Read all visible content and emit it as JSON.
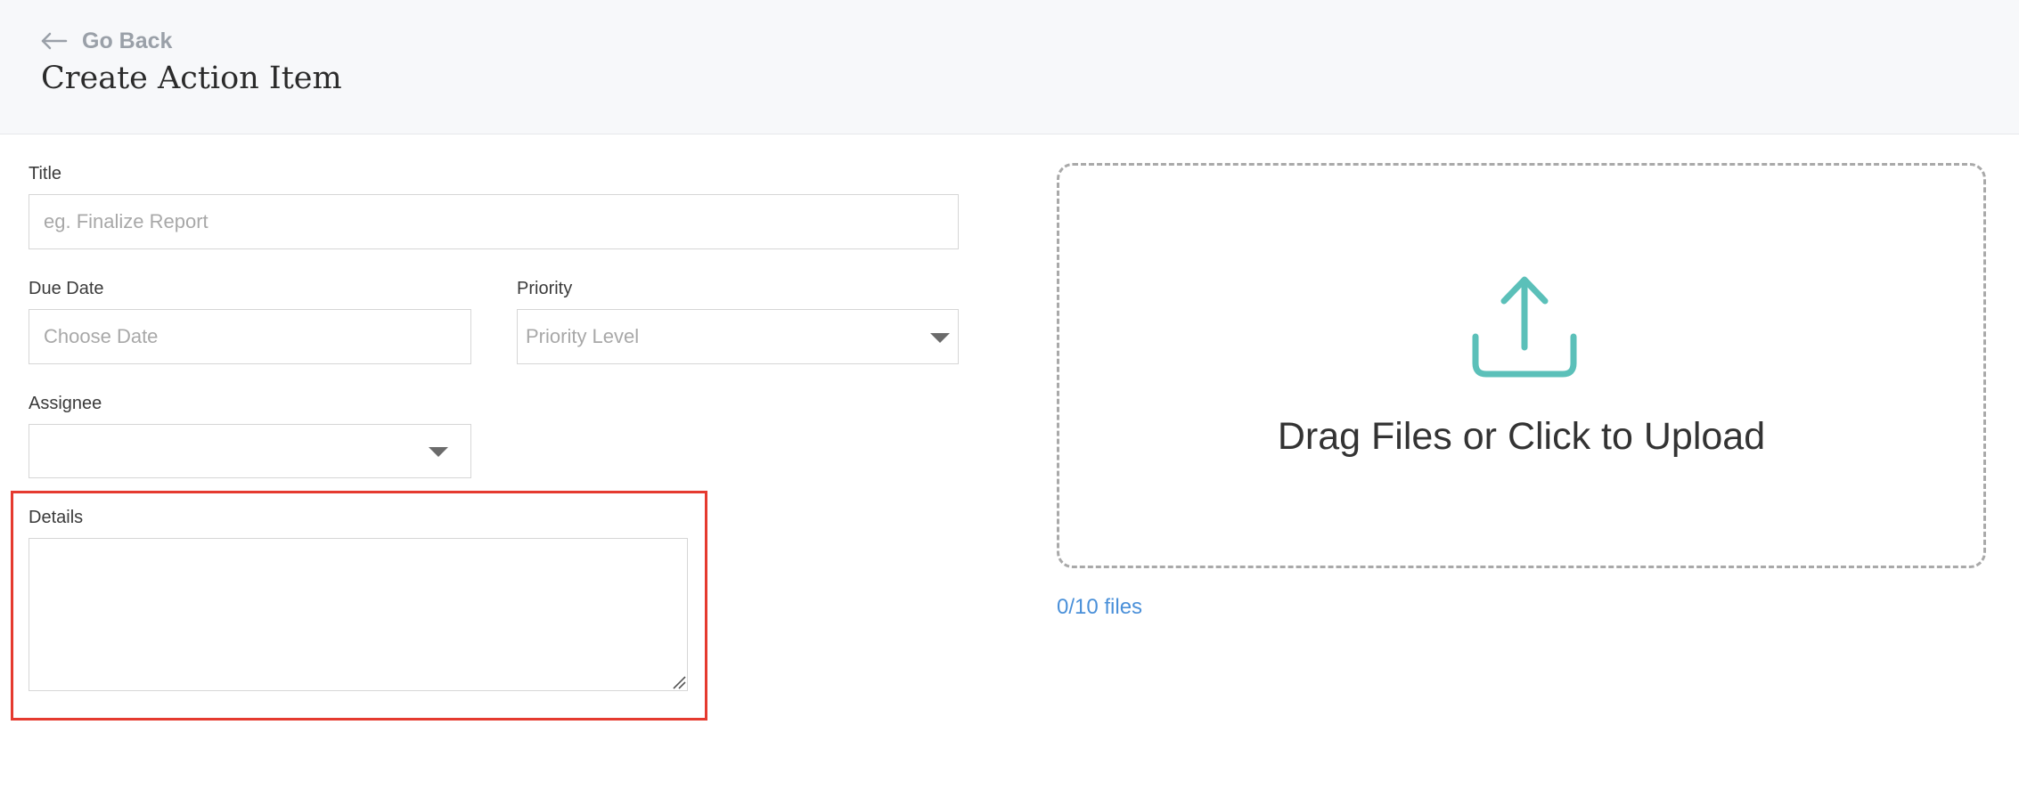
{
  "header": {
    "go_back_label": "Go Back",
    "page_title": "Create Action Item"
  },
  "form": {
    "title": {
      "label": "Title",
      "placeholder": "eg. Finalize Report",
      "value": ""
    },
    "due_date": {
      "label": "Due Date",
      "placeholder": "Choose Date",
      "value": ""
    },
    "priority": {
      "label": "Priority",
      "selected": "Priority Level"
    },
    "assignee": {
      "label": "Assignee",
      "selected": ""
    },
    "details": {
      "label": "Details",
      "value": ""
    }
  },
  "upload": {
    "prompt": "Drag Files or Click to Upload",
    "file_count": "0/10 files",
    "accent_color": "#5bc0b9"
  },
  "icons": [
    "arrow-left-icon",
    "chevron-down-icon",
    "upload-icon",
    "resize-grip-icon"
  ],
  "colors": {
    "header_bg": "#f7f8fa",
    "highlight": "#e53a2f",
    "link": "#4a90d9"
  }
}
